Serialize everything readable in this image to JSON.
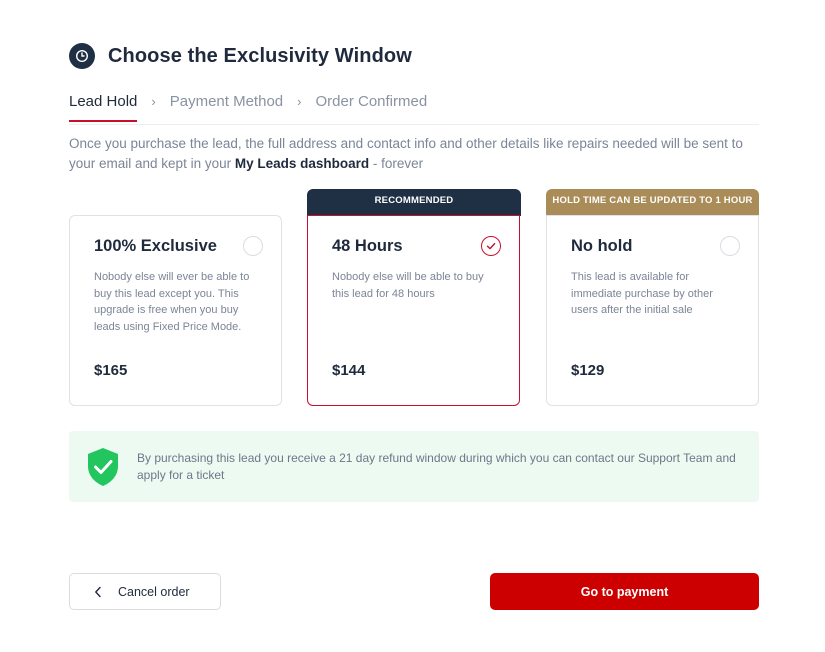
{
  "header": {
    "title": "Choose the Exclusivity Window",
    "icon": "clock-icon"
  },
  "steps": [
    {
      "label": "Lead Hold",
      "active": true
    },
    {
      "label": "Payment Method",
      "active": false
    },
    {
      "label": "Order Confirmed",
      "active": false
    }
  ],
  "intro": {
    "text_before": "Once you purchase the lead, the full address and contact info and other details like repairs needed will be sent to your email and kept in your ",
    "highlight": "My Leads dashboard",
    "text_after": " - forever"
  },
  "options": [
    {
      "title": "100% Exclusive",
      "description": "Nobody else will ever be able to buy this lead except you. This upgrade is free when you buy leads using Fixed Price Mode.",
      "price": "$165",
      "selected": false,
      "banner": ""
    },
    {
      "title": "48 Hours",
      "description": "Nobody else will be able to buy this lead for 48 hours",
      "price": "$144",
      "selected": true,
      "banner": "RECOMMENDED"
    },
    {
      "title": "No hold",
      "description": "This lead is available for immediate purchase by other users after the initial sale",
      "price": "$129",
      "selected": false,
      "banner": "HOLD TIME CAN BE UPDATED TO 1 HOUR"
    }
  ],
  "notice": {
    "icon": "shield-check-icon",
    "text": "By purchasing this lead you receive a 21 day refund window during which you can contact our Support Team and apply for a ticket"
  },
  "actions": {
    "cancel_label": "Cancel order",
    "pay_label": "Go to payment"
  },
  "colors": {
    "accent": "#cc0000",
    "navy": "#1f2f44",
    "gold": "#a98c58",
    "success_bg": "#ecfaf2",
    "success": "#22c55e"
  }
}
